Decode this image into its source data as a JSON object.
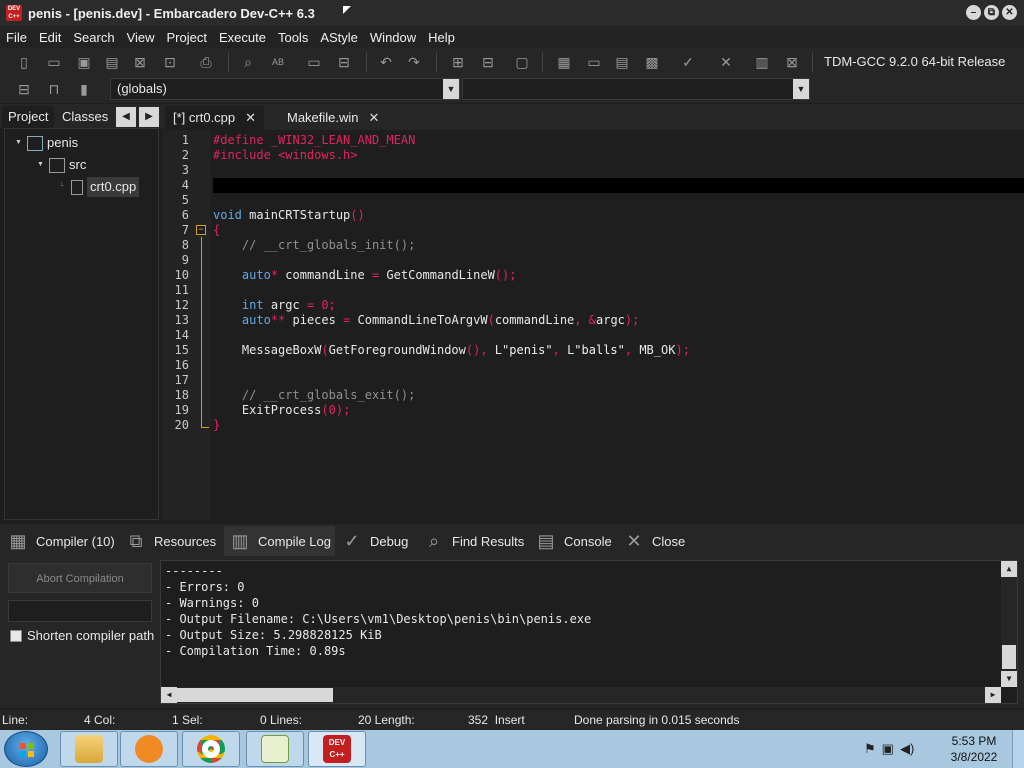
{
  "window": {
    "title": "penis - [penis.dev] - Embarcadero Dev-C++ 6.3",
    "app_icon_text": "DEV C++",
    "minimize": "–",
    "maximize": "⧉",
    "close": "✕"
  },
  "menu": [
    "File",
    "Edit",
    "Search",
    "View",
    "Project",
    "Execute",
    "Tools",
    "AStyle",
    "Window",
    "Help"
  ],
  "toolbar": {
    "compiler": "TDM-GCC 9.2.0 64-bit Release",
    "globals": "(globals)"
  },
  "left_panel": {
    "tabs": [
      "Project",
      "Classes"
    ],
    "tree": [
      {
        "label": "penis",
        "type": "project"
      },
      {
        "label": "src",
        "type": "folder"
      },
      {
        "label": "crt0.cpp",
        "type": "file"
      }
    ]
  },
  "editor_tabs": [
    {
      "label": "[*] crt0.cpp"
    },
    {
      "label": "Makefile.win"
    }
  ],
  "code": {
    "line_numbers": [
      "1",
      "2",
      "3",
      "4",
      "5",
      "6",
      "7",
      "8",
      "9",
      "10",
      "11",
      "12",
      "13",
      "14",
      "15",
      "16",
      "17",
      "18",
      "19",
      "20"
    ],
    "current_line": 4
  },
  "bottom_tabs": [
    {
      "label": "Compiler (10)",
      "icon": "grid-icon"
    },
    {
      "label": "Resources",
      "icon": "resources-icon"
    },
    {
      "label": "Compile Log",
      "icon": "bar-chart-icon"
    },
    {
      "label": "Debug",
      "icon": "check-icon"
    },
    {
      "label": "Find Results",
      "icon": "find-icon"
    },
    {
      "label": "Console",
      "icon": "console-icon"
    },
    {
      "label": "Close",
      "icon": "close-icon"
    }
  ],
  "compile_panel": {
    "abort_label": "Abort Compilation",
    "shorten_label": "Shorten compiler path",
    "log": [
      "--------",
      "- Errors: 0",
      "- Warnings: 0",
      "- Output Filename: C:\\Users\\vm1\\Desktop\\penis\\bin\\penis.exe",
      "- Output Size: 5.298828125 KiB",
      "- Compilation Time: 0.89s"
    ]
  },
  "status": {
    "line": "Line:",
    "col": "4 Col:",
    "sel": "1 Sel:",
    "lines": "0 Lines:",
    "length": "20 Length:",
    "insert": "352  Insert",
    "message": "Done parsing in 0.015 seconds"
  },
  "taskbar": {
    "time": "5:53 PM",
    "date": "3/8/2022",
    "devcpp_label": "DEV C++"
  }
}
